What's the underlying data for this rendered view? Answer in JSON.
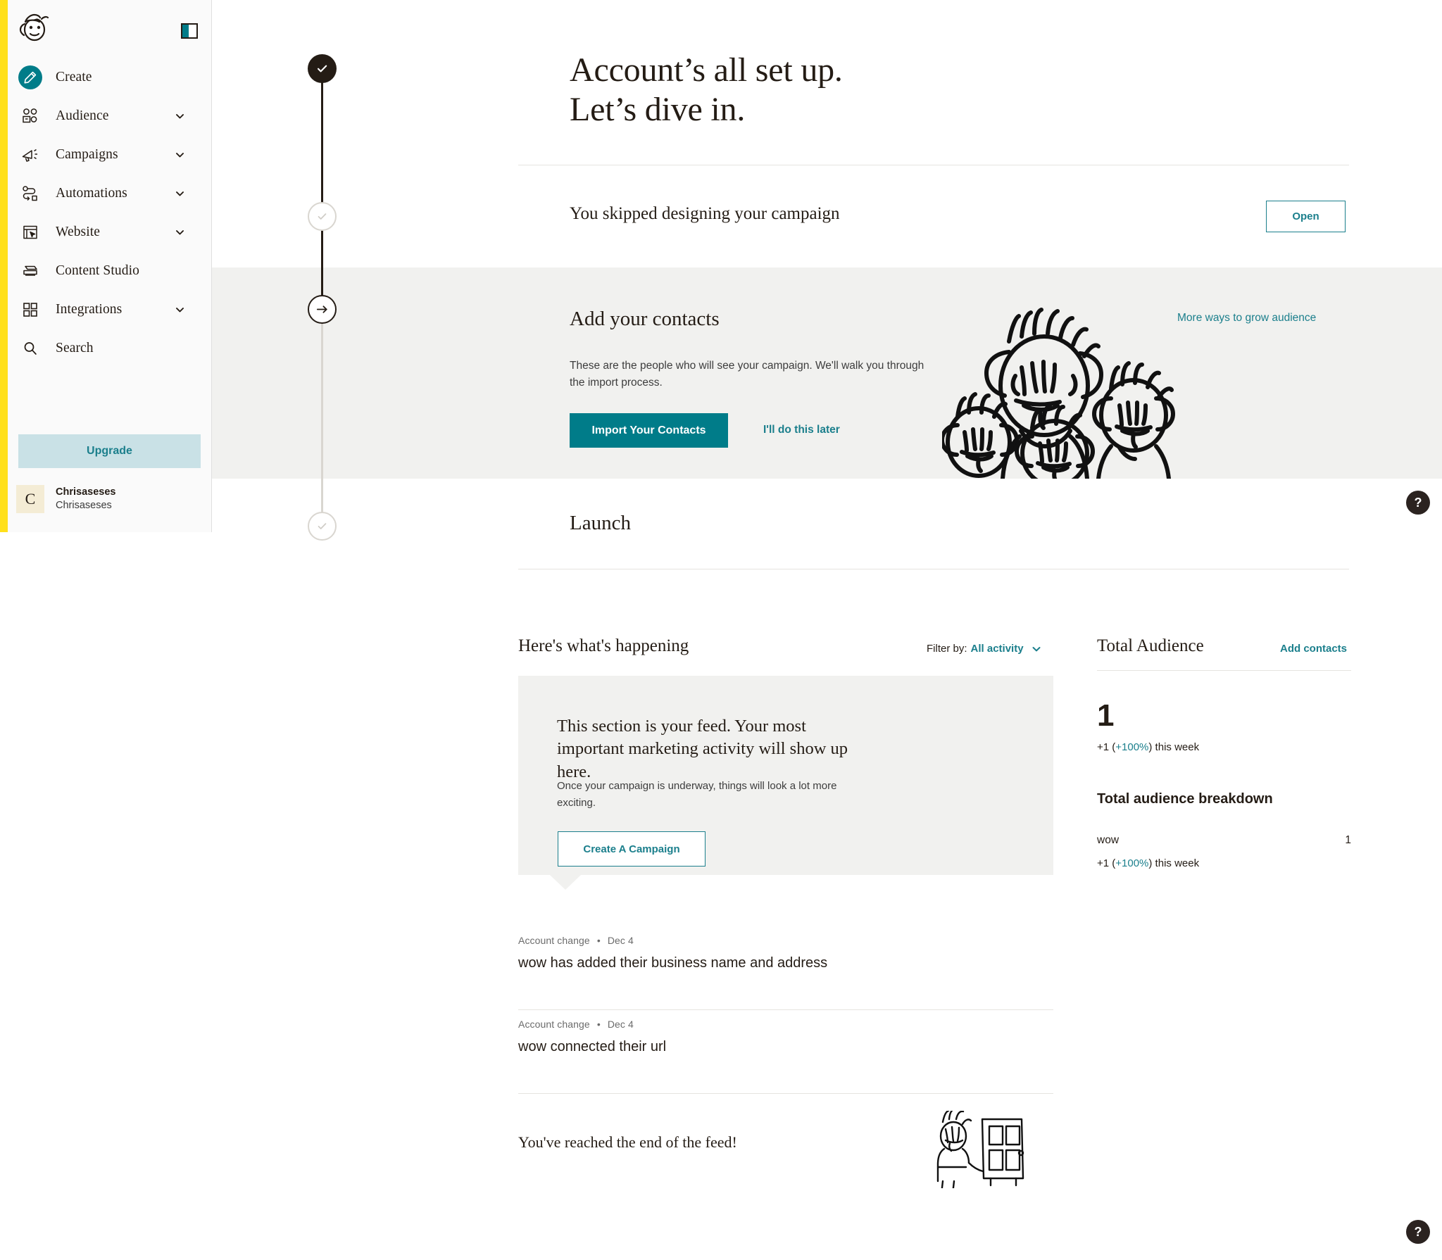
{
  "brand": {
    "logo_icon": "freddie-mailchimp-logo",
    "accent": "#007c89",
    "rail": "#ffe01b",
    "dark": "#241c15"
  },
  "sidebar": {
    "panel_toggle_icon": "panel-collapse-icon",
    "items": [
      {
        "label": "Create",
        "icon": "pencil-icon",
        "expandable": false
      },
      {
        "label": "Audience",
        "icon": "audience-people-icon",
        "expandable": true
      },
      {
        "label": "Campaigns",
        "icon": "megaphone-icon",
        "expandable": true
      },
      {
        "label": "Automations",
        "icon": "automation-flow-icon",
        "expandable": true
      },
      {
        "label": "Website",
        "icon": "website-window-icon",
        "expandable": true
      },
      {
        "label": "Content Studio",
        "icon": "content-studio-icon",
        "expandable": false
      },
      {
        "label": "Integrations",
        "icon": "grid-squares-icon",
        "expandable": true
      },
      {
        "label": "Search",
        "icon": "search-icon",
        "expandable": false
      }
    ],
    "upgrade_label": "Upgrade",
    "account": {
      "initial": "C",
      "name": "Chrisaseses",
      "sub": "Chrisaseses"
    }
  },
  "onboarding": {
    "hero_line1": "Account’s all set up.",
    "hero_line2": "Let’s dive in.",
    "steps": [
      {
        "title": "You skipped designing your campaign",
        "state": "idle",
        "action_label": "Open"
      },
      {
        "title": "Add your contacts",
        "state": "active",
        "description": "These are the people who will see your campaign. We'll walk you through the import process.",
        "primary_label": "Import Your Contacts",
        "secondary_label": "I'll do this later",
        "side_link": "More ways to grow audience",
        "illustration_icon": "crowd-of-faces-illustration"
      },
      {
        "title": "Launch",
        "state": "idle"
      }
    ]
  },
  "feed": {
    "heading": "Here's what's happening",
    "filter_label": "Filter by:",
    "filter_value": "All activity",
    "filter_chevron_icon": "chevron-down-icon",
    "empty_card": {
      "title": "This section is your feed. Your most important marketing activity will show up here.",
      "subtitle": "Once your campaign is underway, things will look a lot more exciting.",
      "cta_label": "Create A Campaign"
    },
    "items": [
      {
        "type": "Account change",
        "separator": "•",
        "date": "Dec 4",
        "text": "wow has added their business name and address"
      },
      {
        "type": "Account change",
        "separator": "•",
        "date": "Dec 4",
        "text": "wow connected their url"
      }
    ],
    "end_text": "You've reached the end of the feed!",
    "end_illustration_icon": "person-with-door-illustration"
  },
  "audience_panel": {
    "title": "Total Audience",
    "add_link": "Add contacts",
    "total": "1",
    "total_delta_prefix": "+1 (",
    "total_delta_pct": "+100%",
    "total_delta_suffix": ") this week",
    "breakdown_title": "Total audience breakdown",
    "rows": [
      {
        "name": "wow",
        "count": "1",
        "delta_prefix": "+1 (",
        "delta_pct": "+100%",
        "delta_suffix": ") this week"
      }
    ]
  },
  "help": {
    "icon": "question-mark-icon",
    "label": "?"
  }
}
